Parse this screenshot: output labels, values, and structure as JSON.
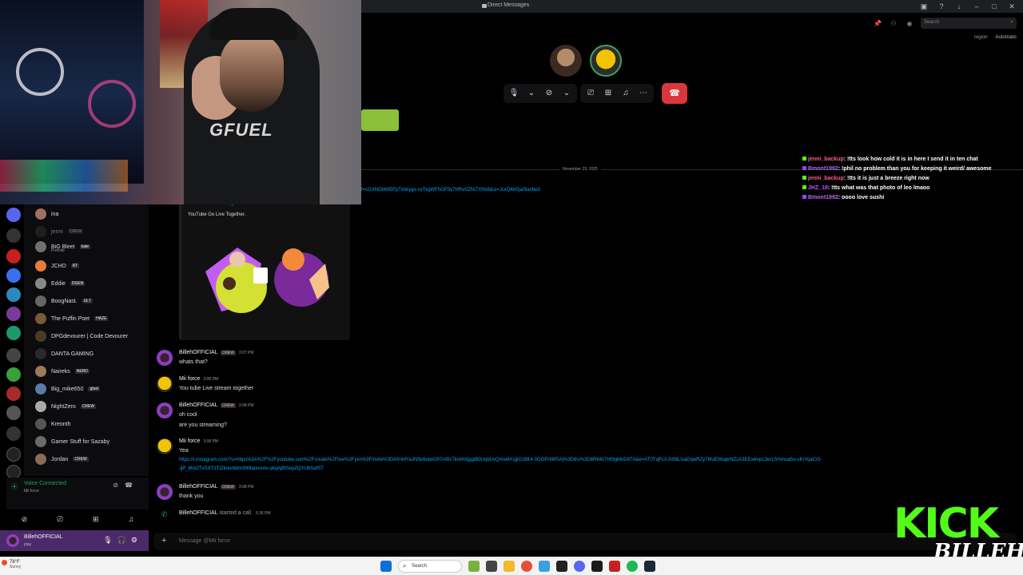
{
  "window": {
    "title": "Direct Messages",
    "search_placeholder": "Search",
    "region_label": "region",
    "region_value": "Automatic"
  },
  "call": {
    "participants": [
      "Billeh",
      "Mii force"
    ]
  },
  "chat": {
    "date_divider": "November 23, 2025",
    "embed_link_tail": "f=cGXNGb685FpTxhkygx-vyTkgWFhGP3y7Hfhv0ZNI7XHx8&si=JcxQ4kGjaSlavbe3",
    "embed_title": "YouTube Go Live Together",
    "embed_desc": "YouTube Go Live Together.",
    "messages": [
      {
        "author": "BillehOFFICIAL",
        "tag": "CREW",
        "time": "3:07 PM",
        "lines": [
          "whats that?"
        ]
      },
      {
        "author": "Mii force",
        "tag": "",
        "time": "3:08 PM",
        "lines": [
          "You tube Live stream together"
        ]
      },
      {
        "author": "BillehOFFICIAL",
        "tag": "CREW",
        "time": "3:08 PM",
        "lines": [
          "oh cool",
          "are you streaming?"
        ]
      },
      {
        "author": "Mii force",
        "tag": "",
        "time": "3:08 PM",
        "lines": [
          "Yea"
        ],
        "link1": "https://l.instagram.com/?u=https%3A%2F%2Fyoutube.com%2Fcreate%2Flive%2Fjoin%3Finvite%3DAfmMYaJNSk6otwG97mBxTitvkhXjggiB0UqbUvQmw8XsjjiGz8K4-0OOPr8MSAj%3D6si%3D6R64z7Hf3gMnD87A&e=AT0TqPcXJn98LIxaDqwRZy7MuEh6aprNZzA3EEwlmpL3erL5rhinoa5o-xKrYqaCiS-",
        "link2": "JjP_Mot2TvSXT1TIZkourkbm3WltaixvxAv-qkqAjBISeyZQYUbSafST"
      },
      {
        "author": "BillehOFFICIAL",
        "tag": "CREW",
        "time": "3:08 PM",
        "lines": [
          "thank you"
        ]
      },
      {
        "author": "BillehOFFICIAL",
        "tag": "",
        "time": "5:36 PM",
        "system": "started a call."
      }
    ],
    "input_placeholder": "Message @Mii force"
  },
  "members": [
    {
      "name": "ina",
      "tag": ""
    },
    {
      "name": "jenni",
      "tag": "CREW"
    },
    {
      "name": "BiG Bleet",
      "tag": "kate",
      "sub": "Fortnite"
    },
    {
      "name": "JCHD",
      "tag": "RT"
    },
    {
      "name": "Eddie",
      "tag": "DGEN"
    },
    {
      "name": "BoogNast.",
      "tag": "ULT"
    },
    {
      "name": "The Puffin Poet",
      "tag": "HAZE"
    },
    {
      "name": "DPGdevourer | Code Devourer",
      "tag": ""
    },
    {
      "name": "DANTA GAMING",
      "tag": ""
    },
    {
      "name": "Naireks",
      "tag": "NERD"
    },
    {
      "name": "Big_mike650",
      "tag": "gfuel"
    },
    {
      "name": "NightZero",
      "tag": "CREW"
    },
    {
      "name": "Kreonth",
      "tag": ""
    },
    {
      "name": "Gamer Stuff for Sazaby",
      "tag": ""
    },
    {
      "name": "Jordan",
      "tag": "CREW"
    }
  ],
  "voice": {
    "status": "Voice Connected",
    "channel": "Mii force"
  },
  "user": {
    "name": "BillehOFFICIAL",
    "status": "play"
  },
  "overlay_chat": [
    {
      "user": "jenni_backup",
      "msg": ": !tts look how cold it is in here I send it in ten chat"
    },
    {
      "user": "Bmont1992",
      "msg": ": !phil no problem than you for keeping it weird/ awesome"
    },
    {
      "user": "jenni_backup",
      "msg": ": !tts it is just a breeze right now"
    },
    {
      "user": "JHZ_18",
      "msg": ": !tts what was that photo of leo lmaoo"
    },
    {
      "user": "Bmont1992",
      "msg": ": oooo love sushi"
    }
  ],
  "webcam": {
    "shirt_logo": "GFUEL"
  },
  "branding": {
    "kick": "KICK",
    "billeh": "BILLEH"
  },
  "taskbar": {
    "temp": "78°F",
    "condition": "Sunny",
    "search": "Search"
  },
  "colors": {
    "accent_green": "#53fc18",
    "hangup_red": "#da373c",
    "link_blue": "#00a8fc",
    "user_purple": "#4c2a6a"
  }
}
